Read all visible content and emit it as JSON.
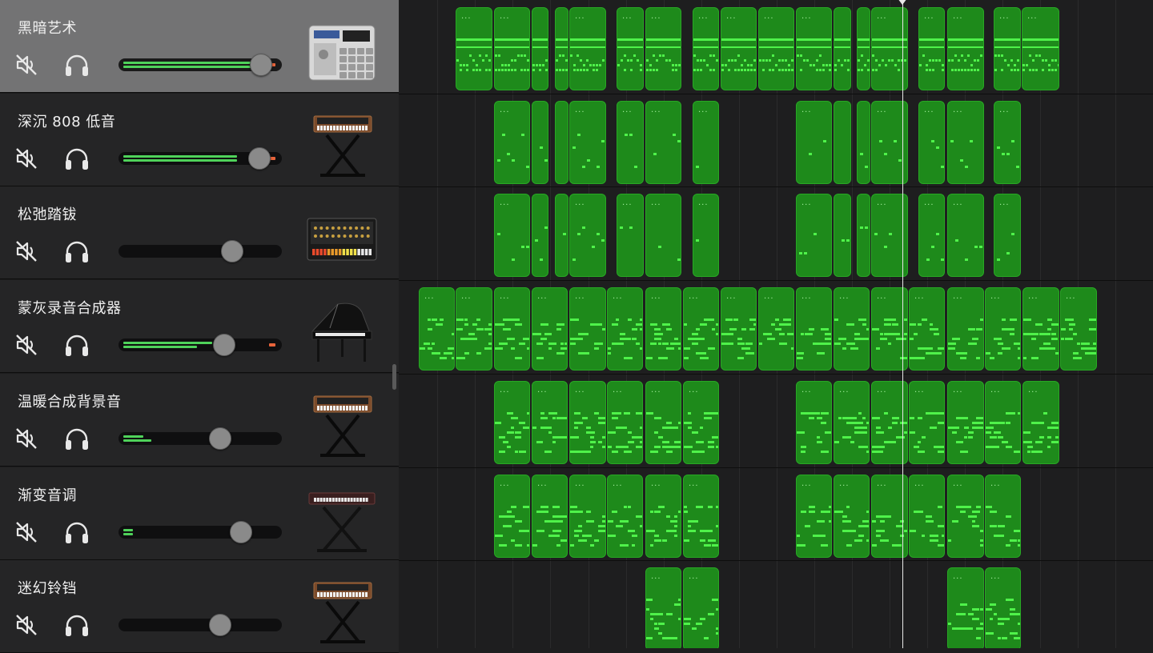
{
  "tracks": [
    {
      "name": "黑暗艺术",
      "instrument": "drum-machine-mpc-icon",
      "selected": true,
      "volume": 0.93,
      "meter_top": 0.88,
      "meter_bot": 0.88,
      "clip": true
    },
    {
      "name": "深沉 808 低音",
      "instrument": "synth-keyboard-stand-icon",
      "selected": false,
      "volume": 0.92,
      "meter_top": 0.74,
      "meter_bot": 0.74,
      "clip": true
    },
    {
      "name": "松弛踏钹",
      "instrument": "drum-machine-808-icon",
      "selected": false,
      "volume": 0.73,
      "meter_top": 0,
      "meter_bot": 0,
      "clip": false
    },
    {
      "name": "蒙灰录音合成器",
      "instrument": "grand-piano-icon",
      "selected": false,
      "volume": 0.67,
      "meter_top": 0.58,
      "meter_bot": 0.48,
      "clip": true
    },
    {
      "name": "温暖合成背景音",
      "instrument": "synth-keyboard-stand-icon",
      "selected": false,
      "volume": 0.64,
      "meter_top": 0.13,
      "meter_bot": 0.18,
      "clip": false
    },
    {
      "name": "渐变音调",
      "instrument": "keyboard-stand-icon",
      "selected": false,
      "volume": 0.79,
      "meter_top": 0.06,
      "meter_bot": 0.06,
      "clip": false
    },
    {
      "name": "迷幻铃铛",
      "instrument": "synth-keyboard-stand-icon",
      "selected": false,
      "volume": 0.64,
      "meter_top": 0,
      "meter_bot": 0,
      "clip": false
    }
  ],
  "icons": {
    "mute": "speaker-mute-icon",
    "solo": "headphones-icon"
  },
  "colors": {
    "region": "#1e8a1b",
    "note": "#4ff24a",
    "clip": "#e8643b",
    "meter": "#4fd25a"
  },
  "region_label": "···"
}
